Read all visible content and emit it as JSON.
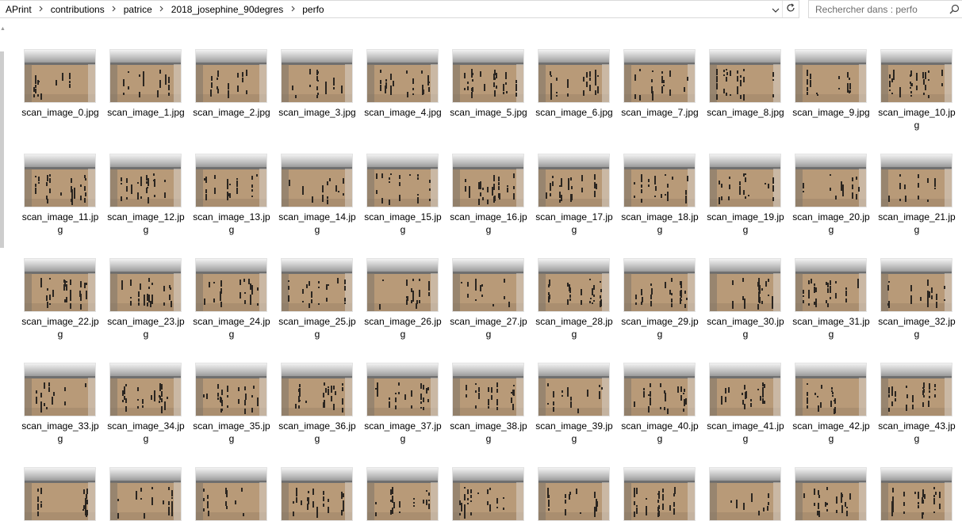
{
  "breadcrumb": [
    "APrint",
    "contributions",
    "patrice",
    "2018_josephine_90degres",
    "perfo"
  ],
  "search": {
    "placeholder": "Rechercher dans : perfo"
  },
  "icons": {
    "breadcrumb_separator": "chevron-right-icon",
    "address_dropdown": "chevron-down-icon",
    "refresh": "refresh-icon",
    "search": "search-icon"
  },
  "colors": {
    "paper": "#b89a78",
    "holes": "#2a2520",
    "machine": "#8e8e8e"
  },
  "files": [
    "scan_image_0.jpg",
    "scan_image_1.jpg",
    "scan_image_2.jpg",
    "scan_image_3.jpg",
    "scan_image_4.jpg",
    "scan_image_5.jpg",
    "scan_image_6.jpg",
    "scan_image_7.jpg",
    "scan_image_8.jpg",
    "scan_image_9.jpg",
    "scan_image_10.jpg",
    "scan_image_11.jpg",
    "scan_image_12.jpg",
    "scan_image_13.jpg",
    "scan_image_14.jpg",
    "scan_image_15.jpg",
    "scan_image_16.jpg",
    "scan_image_17.jpg",
    "scan_image_18.jpg",
    "scan_image_19.jpg",
    "scan_image_20.jpg",
    "scan_image_21.jpg",
    "scan_image_22.jpg",
    "scan_image_23.jpg",
    "scan_image_24.jpg",
    "scan_image_25.jpg",
    "scan_image_26.jpg",
    "scan_image_27.jpg",
    "scan_image_28.jpg",
    "scan_image_29.jpg",
    "scan_image_30.jpg",
    "scan_image_31.jpg",
    "scan_image_32.jpg",
    "scan_image_33.jpg",
    "scan_image_34.jpg",
    "scan_image_35.jpg",
    "scan_image_36.jpg",
    "scan_image_37.jpg",
    "scan_image_38.jpg",
    "scan_image_39.jpg",
    "scan_image_40.jpg",
    "scan_image_41.jpg",
    "scan_image_42.jpg",
    "scan_image_43.jpg",
    "",
    "",
    "",
    "",
    "",
    "",
    "",
    "",
    "",
    "",
    ""
  ]
}
